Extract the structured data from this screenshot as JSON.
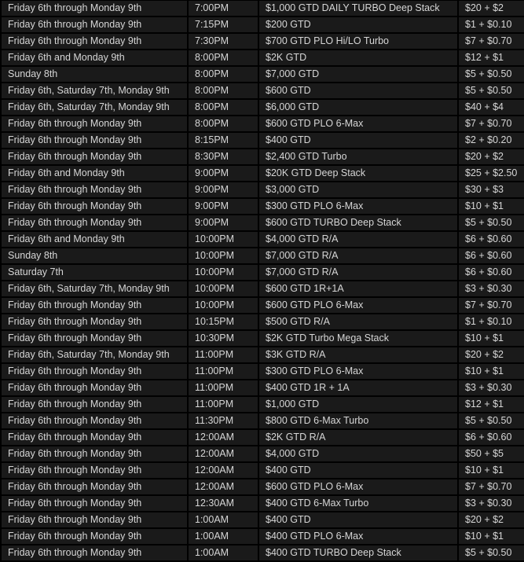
{
  "schedule": {
    "rows": [
      {
        "days": "Friday 6th through Monday 9th",
        "time": "7:00PM",
        "event": "$1,000 GTD DAILY TURBO Deep Stack",
        "buyin": "$20 + $2"
      },
      {
        "days": "Friday 6th through Monday 9th",
        "time": "7:15PM",
        "event": "$200 GTD",
        "buyin": "$1 + $0.10"
      },
      {
        "days": "Friday 6th through Monday 9th",
        "time": "7:30PM",
        "event": "$700 GTD PLO Hi/LO Turbo",
        "buyin": "$7 + $0.70"
      },
      {
        "days": "Friday 6th and Monday 9th",
        "time": "8:00PM",
        "event": "$2K GTD",
        "buyin": "$12 + $1"
      },
      {
        "days": "Sunday 8th",
        "time": "8:00PM",
        "event": "$7,000 GTD",
        "buyin": "$5 + $0.50"
      },
      {
        "days": "Friday 6th, Saturday 7th, Monday 9th",
        "time": "8:00PM",
        "event": "$600 GTD",
        "buyin": "$5 + $0.50"
      },
      {
        "days": "Friday 6th, Saturday 7th, Monday 9th",
        "time": "8:00PM",
        "event": "$6,000 GTD",
        "buyin": "$40 + $4"
      },
      {
        "days": "Friday 6th through Monday 9th",
        "time": "8:00PM",
        "event": "$600 GTD PLO 6-Max",
        "buyin": "$7 + $0.70"
      },
      {
        "days": "Friday 6th through Monday 9th",
        "time": "8:15PM",
        "event": "$400 GTD",
        "buyin": "$2 + $0.20"
      },
      {
        "days": "Friday 6th through Monday 9th",
        "time": "8:30PM",
        "event": "$2,400 GTD Turbo",
        "buyin": "$20 + $2"
      },
      {
        "days": "Friday 6th and Monday 9th",
        "time": "9:00PM",
        "event": "$20K GTD Deep Stack",
        "buyin": "$25 + $2.50"
      },
      {
        "days": "Friday 6th through Monday 9th",
        "time": "9:00PM",
        "event": "$3,000 GTD",
        "buyin": "$30 + $3"
      },
      {
        "days": "Friday 6th through Monday 9th",
        "time": "9:00PM",
        "event": "$300 GTD PLO 6-Max",
        "buyin": "$10 + $1"
      },
      {
        "days": "Friday 6th through Monday 9th",
        "time": "9:00PM",
        "event": "$600 GTD TURBO Deep Stack",
        "buyin": "$5 + $0.50"
      },
      {
        "days": "Friday 6th and Monday 9th",
        "time": "10:00PM",
        "event": "$4,000 GTD R/A",
        "buyin": "$6 + $0.60"
      },
      {
        "days": "Sunday 8th",
        "time": "10:00PM",
        "event": "$7,000 GTD R/A",
        "buyin": "$6 + $0.60"
      },
      {
        "days": "Saturday 7th",
        "time": "10:00PM",
        "event": "$7,000 GTD R/A",
        "buyin": "$6 + $0.60"
      },
      {
        "days": "Friday 6th, Saturday 7th, Monday 9th",
        "time": "10:00PM",
        "event": "$600 GTD 1R+1A",
        "buyin": "$3 + $0.30"
      },
      {
        "days": "Friday 6th through Monday 9th",
        "time": "10:00PM",
        "event": "$600 GTD PLO 6-Max",
        "buyin": "$7 + $0.70"
      },
      {
        "days": "Friday 6th through Monday 9th",
        "time": "10:15PM",
        "event": "$500 GTD R/A",
        "buyin": "$1 + $0.10"
      },
      {
        "days": "Friday 6th through Monday 9th",
        "time": "10:30PM",
        "event": "$2K GTD Turbo Mega Stack",
        "buyin": "$10 + $1"
      },
      {
        "days": "Friday 6th, Saturday 7th, Monday 9th",
        "time": "11:00PM",
        "event": "$3K GTD R/A",
        "buyin": "$20 + $2"
      },
      {
        "days": "Friday 6th through Monday 9th",
        "time": "11:00PM",
        "event": "$300 GTD PLO 6-Max",
        "buyin": "$10 + $1"
      },
      {
        "days": "Friday 6th through Monday 9th",
        "time": "11:00PM",
        "event": "$400 GTD 1R + 1A",
        "buyin": "$3 + $0.30"
      },
      {
        "days": "Friday 6th through Monday 9th",
        "time": "11:00PM",
        "event": "$1,000 GTD",
        "buyin": "$12 + $1"
      },
      {
        "days": "Friday 6th through Monday 9th",
        "time": "11:30PM",
        "event": "$800 GTD 6-Max Turbo",
        "buyin": "$5 + $0.50"
      },
      {
        "days": "Friday 6th through Monday 9th",
        "time": "12:00AM",
        "event": "$2K GTD R/A",
        "buyin": "$6 + $0.60"
      },
      {
        "days": "Friday 6th through Monday 9th",
        "time": "12:00AM",
        "event": "$4,000 GTD",
        "buyin": "$50 + $5"
      },
      {
        "days": "Friday 6th through Monday 9th",
        "time": "12:00AM",
        "event": "$400 GTD",
        "buyin": "$10 + $1"
      },
      {
        "days": "Friday 6th through Monday 9th",
        "time": "12:00AM",
        "event": "$600 GTD PLO 6-Max",
        "buyin": "$7 + $0.70"
      },
      {
        "days": "Friday 6th through Monday 9th",
        "time": "12:30AM",
        "event": "$400 GTD 6-Max Turbo",
        "buyin": "$3 + $0.30"
      },
      {
        "days": "Friday 6th through Monday 9th",
        "time": "1:00AM",
        "event": "$400 GTD",
        "buyin": "$20 + $2"
      },
      {
        "days": "Friday 6th through Monday 9th",
        "time": "1:00AM",
        "event": "$400 GTD PLO 6-Max",
        "buyin": "$10 + $1"
      },
      {
        "days": "Friday 6th through Monday 9th",
        "time": "1:00AM",
        "event": "$400 GTD TURBO Deep Stack",
        "buyin": "$5 + $0.50"
      }
    ]
  }
}
